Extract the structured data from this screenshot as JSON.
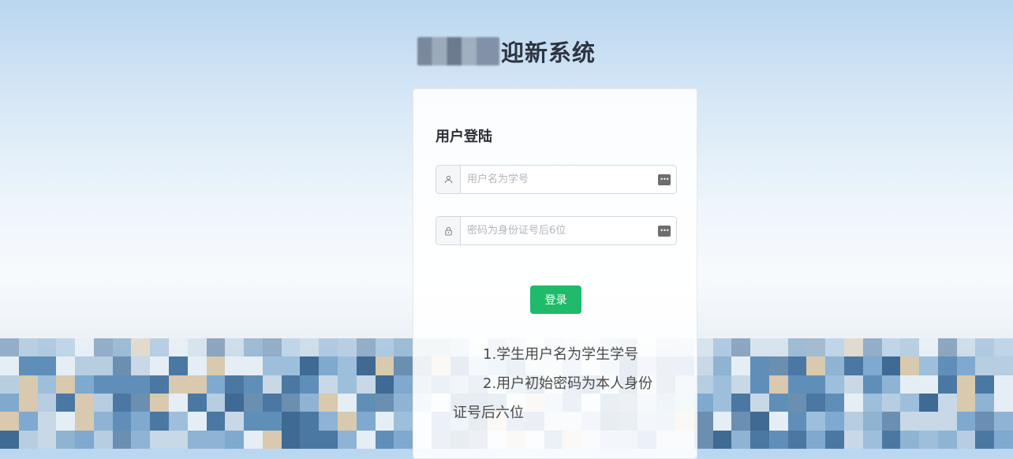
{
  "header": {
    "title": "迎新系统"
  },
  "login": {
    "heading": "用户登陆",
    "username": {
      "placeholder": "用户名为学号",
      "value": ""
    },
    "password": {
      "placeholder": "密码为身份证号后6位",
      "value": ""
    },
    "submit_label": "登录",
    "password_badge": "•••"
  },
  "notes": {
    "line1": "1.学生用户名为学生学号",
    "line2": "2.用户初始密码为本人身份",
    "line3": "证号后六位"
  },
  "colors": {
    "accent": "#1fba6a",
    "text": "#2b2f36"
  }
}
